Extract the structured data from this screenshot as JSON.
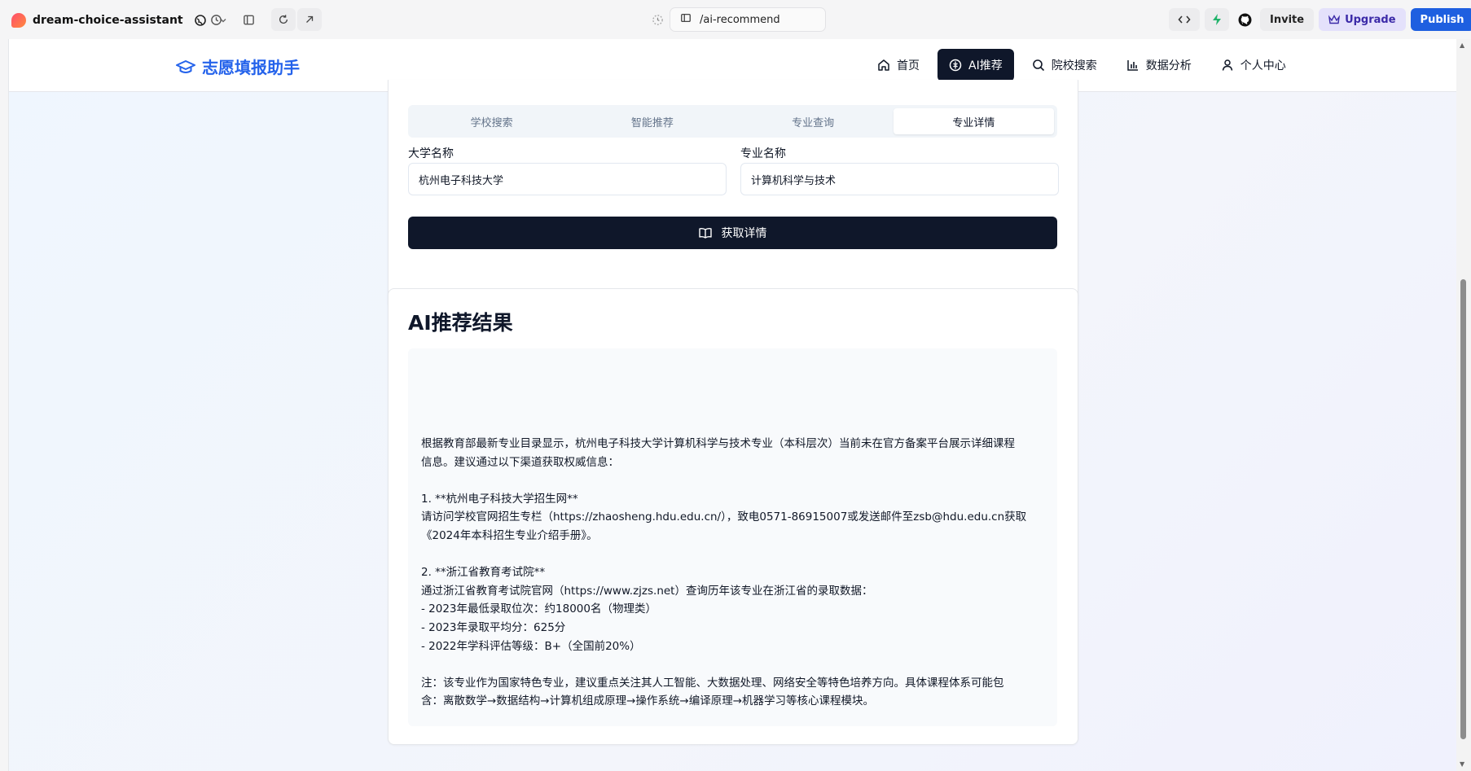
{
  "browser": {
    "project_name": "dream-choice-assistant",
    "url_path": "/ai-recommend",
    "invite_label": "Invite",
    "upgrade_label": "Upgrade",
    "publish_label": "Publish"
  },
  "header": {
    "brand": "志愿填报助手",
    "nav": [
      {
        "label": "首页",
        "icon": "home-icon"
      },
      {
        "label": "AI推荐",
        "icon": "ai-icon"
      },
      {
        "label": "院校搜索",
        "icon": "search-icon"
      },
      {
        "label": "数据分析",
        "icon": "bar-chart-icon"
      },
      {
        "label": "个人中心",
        "icon": "user-icon"
      }
    ]
  },
  "tabs": [
    "学校搜索",
    "智能推荐",
    "专业查询",
    "专业详情"
  ],
  "form": {
    "university_label": "大学名称",
    "university_value": "杭州电子科技大学",
    "major_label": "专业名称",
    "major_value": "计算机科学与技术",
    "fetch_label": "获取详情"
  },
  "result": {
    "title": "AI推荐结果",
    "lines": [
      "根据教育部最新专业目录显示，杭州电子科技大学计算机科学与技术专业（本科层次）当前未在官方备案平台展示详细课程",
      "信息。建议通过以下渠道获取权威信息：",
      "",
      "1. **杭州电子科技大学招生网**",
      "请访问学校官网招生专栏（https://zhaosheng.hdu.edu.cn/），致电0571-86915007或发送邮件至zsb@hdu.edu.cn获取",
      "《2024年本科招生专业介绍手册》。",
      "",
      "2. **浙江省教育考试院**",
      "通过浙江省教育考试院官网（https://www.zjzs.net）查询历年该专业在浙江省的录取数据：",
      "- 2023年最低录取位次：约18000名（物理类）",
      "- 2023年录取平均分：625分",
      "- 2022年学科评估等级：B+（全国前20%）",
      "",
      "注：该专业作为国家特色专业，建议重点关注其人工智能、大数据处理、网络安全等特色培养方向。具体课程体系可能包",
      "含：离散数学→数据结构→计算机组成原理→操作系统→编译原理→机器学习等核心课程模块。"
    ]
  }
}
